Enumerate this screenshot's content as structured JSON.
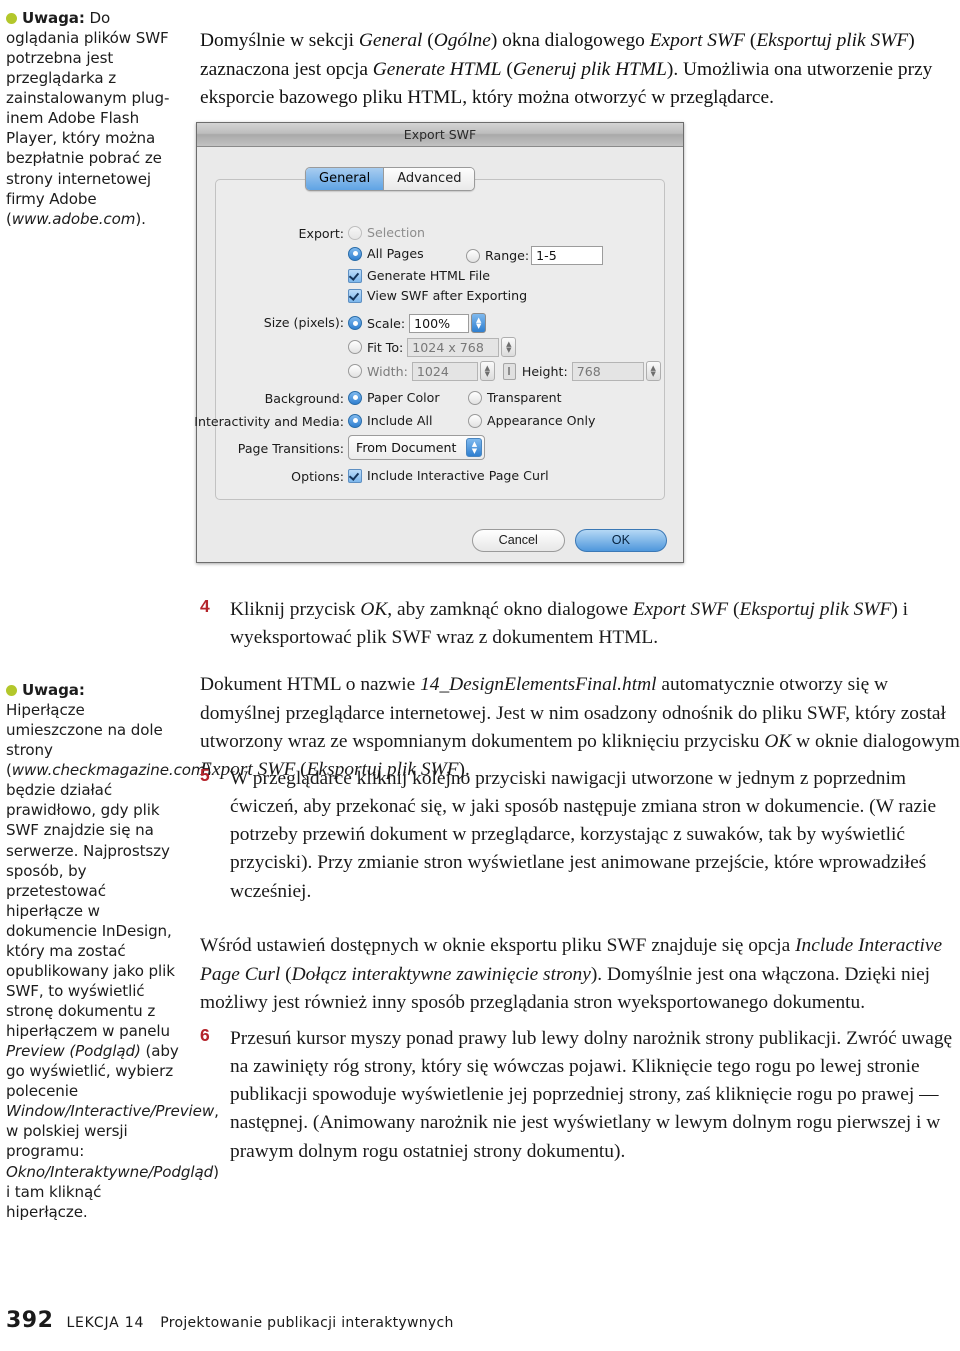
{
  "sidenotes": [
    {
      "bullet_color": "#b3c72b",
      "label": "Uwaga:",
      "text_before_italic": " Do oglądania plików SWF potrzebna jest przeglądarka z zainstalowanym plug-inem Adobe Flash Player, który można bezpłatnie pobrać ze strony internetowej firmy Adobe (",
      "italic": "www.adobe.com",
      "text_after_italic": ")."
    },
    {
      "bullet_color": "#b3c72b",
      "label": "Uwaga:",
      "seg1": "Hiperłącze umieszczone na dole strony (",
      "italic1": "www.checkmagazine.com",
      "seg2": ") będzie działać prawidłowo, gdy plik SWF znajdzie się na serwerze. Najprostszy sposób, by przetestować hiperłącze w dokumencie InDesign, który ma zostać opublikowany jako plik SWF, to wyświetlić stronę dokumentu z hiperłączem w panelu ",
      "italic2": "Preview (Podgląd)",
      "seg3": " (aby go wyświetlić, wybierz polecenie ",
      "italic3": "Window/Interactive/Preview",
      "seg4": ", w polskiej wersji programu: ",
      "italic4": "Okno/Interaktywne/Podgląd",
      "seg5": ") i tam kliknąć hiperłącze."
    }
  ],
  "intro_paragraph": {
    "s1": "Domyślnie w sekcji ",
    "i1": "General",
    "s2": " (",
    "i2": "Ogólne",
    "s3": ") okna dialogowego ",
    "i3": "Export SWF",
    "s4": " (",
    "i4": "Eksportuj plik SWF",
    "s5": ") zaznaczona jest opcja ",
    "i5": "Generate HTML",
    "s6": " (",
    "i6": "Generuj plik HTML",
    "s7": "). Umożliwia ona utworzenie przy eksporcie bazowego pliku HTML, który można otworzyć w przeglądarce."
  },
  "dialog": {
    "title": "Export SWF",
    "tabs": [
      {
        "label": "General",
        "active": true
      },
      {
        "label": "Advanced",
        "active": false
      }
    ],
    "labels": {
      "export": "Export:",
      "size": "Size (pixels):",
      "background": "Background:",
      "interactivity": "Interactivity and Media:",
      "page_transitions": "Page Transitions:",
      "options": "Options:"
    },
    "export": {
      "selection": "Selection",
      "all_pages": "All Pages",
      "range": "Range:",
      "range_value": "1-5",
      "generate_html": "Generate HTML File",
      "view_swf": "View SWF after Exporting"
    },
    "size": {
      "scale": "Scale:",
      "scale_value": "100%",
      "fit_to": "Fit To:",
      "fit_to_value": "1024 x 768",
      "width": "Width:",
      "width_value": "1024",
      "height": "Height:",
      "height_value": "768"
    },
    "background": {
      "paper_color": "Paper Color",
      "transparent": "Transparent"
    },
    "interactivity": {
      "include_all": "Include All",
      "appearance_only": "Appearance Only"
    },
    "page_transitions_value": "From Document",
    "options": {
      "include_page_curl": "Include Interactive Page Curl"
    },
    "buttons": {
      "cancel": "Cancel",
      "ok": "OK"
    }
  },
  "steps": {
    "step4": {
      "num": "4",
      "s1": "Kliknij przycisk ",
      "i1": "OK",
      "s2": ", aby zamknąć okno dialogowe ",
      "i2": "Export SWF",
      "s3": " (",
      "i3": "Eksportuj plik SWF",
      "s4": ") i wyeksportować plik SWF wraz z dokumentem HTML."
    },
    "after4": {
      "s1": "Dokument HTML o nazwie ",
      "i1": "14_DesignElementsFinal.html",
      "s2": " automatycznie otworzy się w domyślnej przeglądarce internetowej. Jest w nim osadzony odnośnik do pliku SWF, który został utworzony wraz ze wspomnianym dokumentem po kliknięciu przycisku ",
      "i2": "OK",
      "s3": " w oknie dialogowym ",
      "i3": "Export SWF",
      "s4": " (",
      "i4": "Eksportuj plik SWF",
      "s5": ")."
    },
    "step5": {
      "num": "5",
      "text": "W przeglądarce kliknij kolejno przyciski nawigacji utworzone w jednym z poprzednim ćwiczeń, aby przekonać się, w jaki sposób następuje zmiana stron w dokumencie. (W razie potrzeby przewiń dokument w przeglądarce, korzystając z suwaków, tak by wyświetlić przyciski). Przy zmianie stron wyświetlane jest animowane przejście, które wprowadziłeś wcześniej."
    },
    "after5": {
      "s1": "Wśród ustawień dostępnych w oknie eksportu pliku SWF znajduje się opcja ",
      "i1": "Include Interactive Page Curl",
      "s2": " (",
      "i2": "Dołącz interaktywne zawinięcie strony",
      "s3": "). Domyślnie jest ona włączona. Dzięki niej możliwy jest również inny sposób przeglądania stron wyeksportowanego dokumentu."
    },
    "step6": {
      "num": "6",
      "text": "Przesuń kursor myszy ponad prawy lub lewy dolny narożnik strony publikacji. Zwróć uwagę na zawinięty róg strony, który się wówczas pojawi. Kliknięcie tego rogu po lewej stronie publikacji spowoduje wyświetlenie jej poprzedniej strony, zaś kliknięcie rogu po prawej — następnej. (Animowany narożnik nie jest wyświetlany w lewym dolnym rogu pierwszej i w prawym dolnym rogu ostatniej strony dokumentu)."
    }
  },
  "footer": {
    "page_number": "392",
    "lesson": "LEKCJA 14",
    "chapter": "Projektowanie publikacji interaktywnych"
  },
  "colors": {
    "step_number": "#b4242b",
    "bullet": "#b3c72b",
    "dialog_accent": "#2f7fd0"
  }
}
